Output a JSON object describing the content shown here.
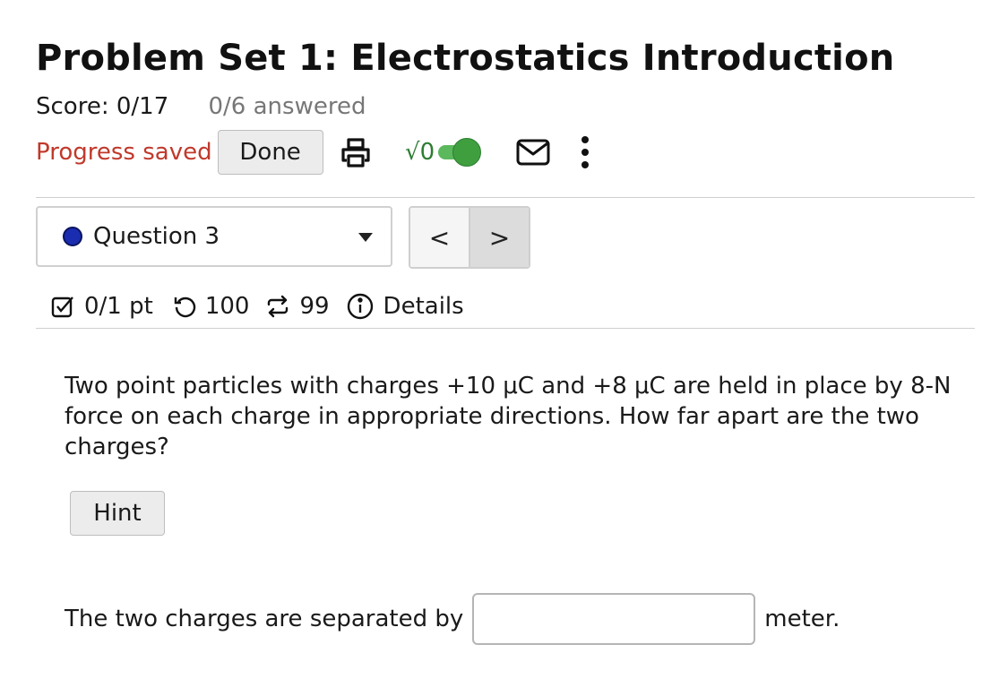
{
  "header": {
    "title": "Problem Set 1: Electrostatics Introduction",
    "score": "Score: 0/17",
    "answered": "0/6 answered"
  },
  "actions": {
    "progress_status": "Progress saved",
    "done_label": "Done",
    "math_toggle_label": "√0",
    "math_toggle_on": true,
    "icons": [
      "printer-icon",
      "envelope-icon",
      "kebab-menu-icon"
    ]
  },
  "question_nav": {
    "selected": "Question 3",
    "status_color": "#1a2db0",
    "prev_label": "<",
    "next_label": ">"
  },
  "meta": {
    "points": "0/1 pt",
    "attempts": "100",
    "versions": "99",
    "details_label": "Details"
  },
  "question": {
    "text": "Two point particles with charges +10 μC and +8 μC are held in place by 8-N force on each charge in appropriate directions. How far apart are the two charges?",
    "hint_label": "Hint",
    "answer_prefix": "The two charges are separated by",
    "answer_value": "",
    "answer_unit": "meter."
  },
  "colors": {
    "progress_saved": "#c0392b",
    "toggle_green": "#3f9f3f"
  }
}
